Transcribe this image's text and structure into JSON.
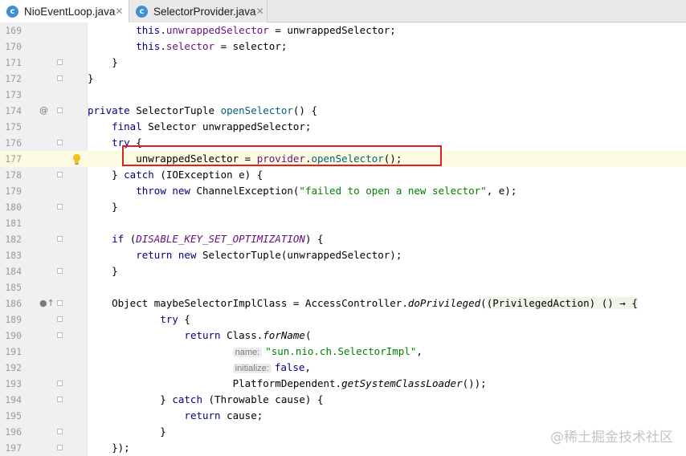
{
  "tabs": [
    {
      "icon_letter": "c",
      "label": "NioEventLoop.java",
      "close": "✕",
      "active": true
    },
    {
      "icon_letter": "c",
      "label": "SelectorProvider.java",
      "close": "✕",
      "active": false
    }
  ],
  "lines": [
    {
      "num": "169",
      "tokens": [
        [
          "",
          "        "
        ],
        [
          "kw",
          "this"
        ],
        [
          "",
          "."
        ],
        [
          "fld",
          "unwrappedSelector"
        ],
        [
          "",
          " = unwrappedSelector;"
        ]
      ]
    },
    {
      "num": "170",
      "tokens": [
        [
          "",
          "        "
        ],
        [
          "kw",
          "this"
        ],
        [
          "",
          "."
        ],
        [
          "fld",
          "selector"
        ],
        [
          "",
          " = selector;"
        ]
      ]
    },
    {
      "num": "171",
      "fold": true,
      "tokens": [
        [
          "",
          "    }"
        ]
      ]
    },
    {
      "num": "172",
      "fold": true,
      "tokens": [
        [
          "",
          "}"
        ]
      ]
    },
    {
      "num": "173",
      "tokens": []
    },
    {
      "num": "174",
      "overlay": "@",
      "fold": true,
      "tokens": [
        [
          "kw",
          "private "
        ],
        [
          "",
          "SelectorTuple "
        ],
        [
          "fn",
          "openSelector"
        ],
        [
          "",
          "() {"
        ]
      ]
    },
    {
      "num": "175",
      "tokens": [
        [
          "",
          "    "
        ],
        [
          "kw",
          "final "
        ],
        [
          "",
          "Selector unwrappedSelector;"
        ]
      ]
    },
    {
      "num": "176",
      "fold": true,
      "tokens": [
        [
          "",
          "    "
        ],
        [
          "kw",
          "try "
        ],
        [
          "",
          "{"
        ]
      ]
    },
    {
      "num": "177",
      "current": true,
      "bulb": true,
      "tokens": [
        [
          "",
          "        unwrappedSelector = "
        ],
        [
          "fld",
          "provider"
        ],
        [
          "",
          "."
        ],
        [
          "fn",
          "openSelector"
        ],
        [
          "",
          "();"
        ]
      ]
    },
    {
      "num": "178",
      "fold": true,
      "tokens": [
        [
          "",
          "    } "
        ],
        [
          "kw",
          "catch "
        ],
        [
          "",
          "(IOException e) {"
        ]
      ]
    },
    {
      "num": "179",
      "tokens": [
        [
          "",
          "        "
        ],
        [
          "kw",
          "throw new "
        ],
        [
          "",
          "ChannelException("
        ],
        [
          "str",
          "\"failed to open a new selector\""
        ],
        [
          "",
          ", e);"
        ]
      ]
    },
    {
      "num": "180",
      "fold": true,
      "tokens": [
        [
          "",
          "    }"
        ]
      ]
    },
    {
      "num": "181",
      "tokens": []
    },
    {
      "num": "182",
      "fold": true,
      "tokens": [
        [
          "",
          "    "
        ],
        [
          "kw",
          "if "
        ],
        [
          "",
          "("
        ],
        [
          "cst",
          "DISABLE_KEY_SET_OPTIMIZATION"
        ],
        [
          "",
          ") {"
        ]
      ]
    },
    {
      "num": "183",
      "tokens": [
        [
          "",
          "        "
        ],
        [
          "kw",
          "return new "
        ],
        [
          "",
          "SelectorTuple(unwrappedSelector);"
        ]
      ]
    },
    {
      "num": "184",
      "fold": true,
      "tokens": [
        [
          "",
          "    }"
        ]
      ]
    },
    {
      "num": "185",
      "tokens": []
    },
    {
      "num": "186",
      "overlay": "●↑",
      "fold": true,
      "tokens": [
        [
          "",
          "    Object maybeSelectorImplClass = AccessController."
        ],
        [
          "it",
          "doPrivileged"
        ],
        [
          "",
          "("
        ],
        [
          "lam",
          "(PrivilegedAction) () → {"
        ]
      ]
    },
    {
      "num": "189",
      "fold": true,
      "tokens": [
        [
          "",
          "            "
        ],
        [
          "kw",
          "try "
        ],
        [
          "",
          "{"
        ]
      ]
    },
    {
      "num": "190",
      "fold": true,
      "tokens": [
        [
          "",
          "                "
        ],
        [
          "kw",
          "return "
        ],
        [
          "",
          "Class."
        ],
        [
          "it",
          "forName"
        ],
        [
          "",
          "("
        ]
      ]
    },
    {
      "num": "191",
      "tokens": [
        [
          "",
          "                        "
        ],
        [
          "hint",
          "name:"
        ],
        [
          "str",
          "\"sun.nio.ch.SelectorImpl\""
        ],
        [
          "",
          ","
        ]
      ]
    },
    {
      "num": "192",
      "tokens": [
        [
          "",
          "                        "
        ],
        [
          "hint",
          "initialize:"
        ],
        [
          "kw",
          "false"
        ],
        [
          "",
          ","
        ]
      ]
    },
    {
      "num": "193",
      "fold": true,
      "tokens": [
        [
          "",
          "                        PlatformDependent."
        ],
        [
          "it",
          "getSystemClassLoader"
        ],
        [
          "",
          "());"
        ]
      ]
    },
    {
      "num": "194",
      "fold": true,
      "tokens": [
        [
          "",
          "            } "
        ],
        [
          "kw",
          "catch "
        ],
        [
          "",
          "(Throwable cause) {"
        ]
      ]
    },
    {
      "num": "195",
      "tokens": [
        [
          "",
          "                "
        ],
        [
          "kw",
          "return "
        ],
        [
          "",
          "cause;"
        ]
      ]
    },
    {
      "num": "196",
      "fold": true,
      "tokens": [
        [
          "",
          "            }"
        ]
      ]
    },
    {
      "num": "197",
      "fold": true,
      "tokens": [
        [
          "",
          "    });"
        ]
      ]
    }
  ],
  "watermark": "@稀土掘金技术社区",
  "colors": {
    "keyword": "#000080",
    "field": "#660e7a",
    "string": "#008000",
    "method": "#00627a",
    "callout": "#e02020",
    "current_line": "#fcfae1"
  }
}
